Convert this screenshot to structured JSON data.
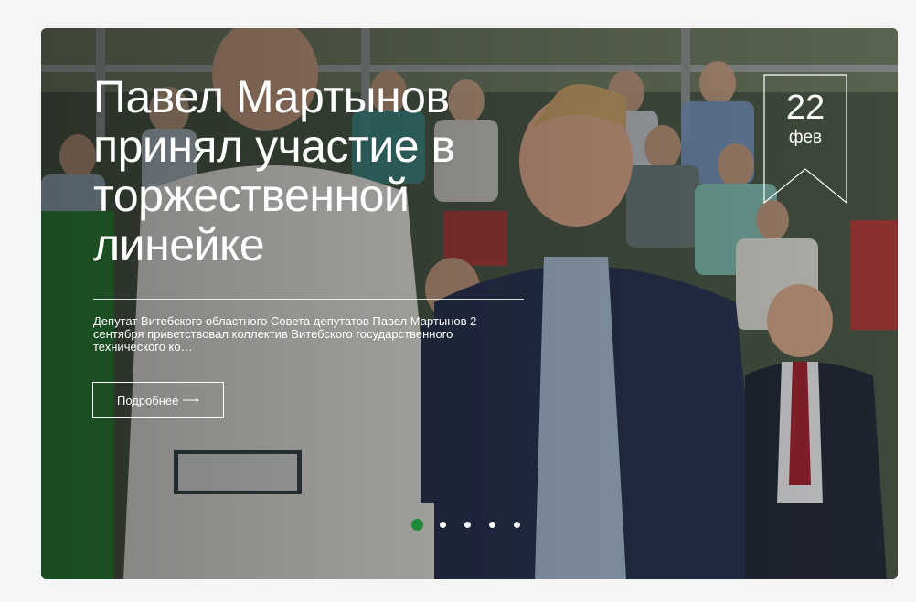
{
  "slide": {
    "title": "Павел Мартынов принял участие в торжественной линейке",
    "lead": "Депутат Витебского областного Совета депутатов Павел Мартынов 2 сентября приветствовал коллектив Витебского государственного технического ко…",
    "more_label": "Подробнее",
    "more_arrow": "⟶",
    "date_day": "22",
    "date_month": "фев"
  },
  "pagination": {
    "count": 5,
    "active_index": 0
  },
  "colors": {
    "accent": "#1d8a3a",
    "text": "#ffffff",
    "page_bg": "#f5f5f5"
  }
}
